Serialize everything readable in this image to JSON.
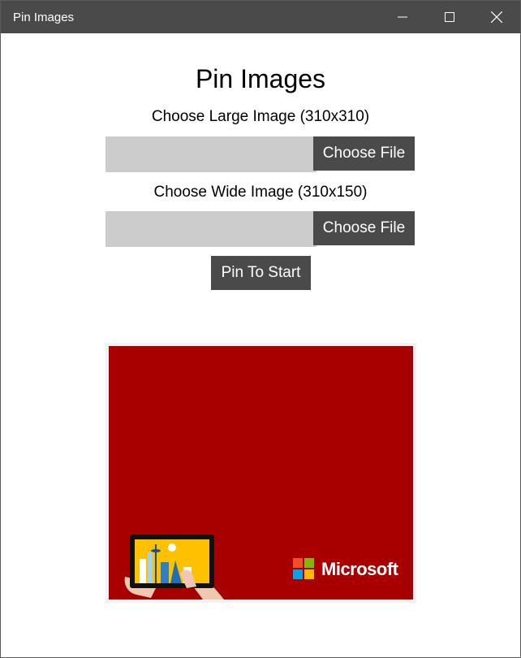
{
  "window": {
    "title": "Pin Images",
    "controls": {
      "minimize_icon": "minimize-icon",
      "maximize_icon": "maximize-icon",
      "close_icon": "close-icon"
    }
  },
  "main": {
    "heading": "Pin Images",
    "large_image": {
      "label": "Choose Large Image (310x310)",
      "path_value": "",
      "button_label": "Choose File"
    },
    "wide_image": {
      "label": "Choose Wide Image (310x150)",
      "path_value": "",
      "button_label": "Choose File"
    },
    "pin_button_label": "Pin To Start"
  },
  "preview": {
    "brand_text": "Microsoft",
    "background_color": "#a80000",
    "logo_colors": [
      "#f25022",
      "#7fba00",
      "#00a4ef",
      "#ffb900"
    ],
    "illustration_icon": "tablet-city-illustration"
  },
  "colors": {
    "titlebar": "#4a4a4a",
    "button": "#4a4a4a",
    "input": "#cccccc"
  }
}
